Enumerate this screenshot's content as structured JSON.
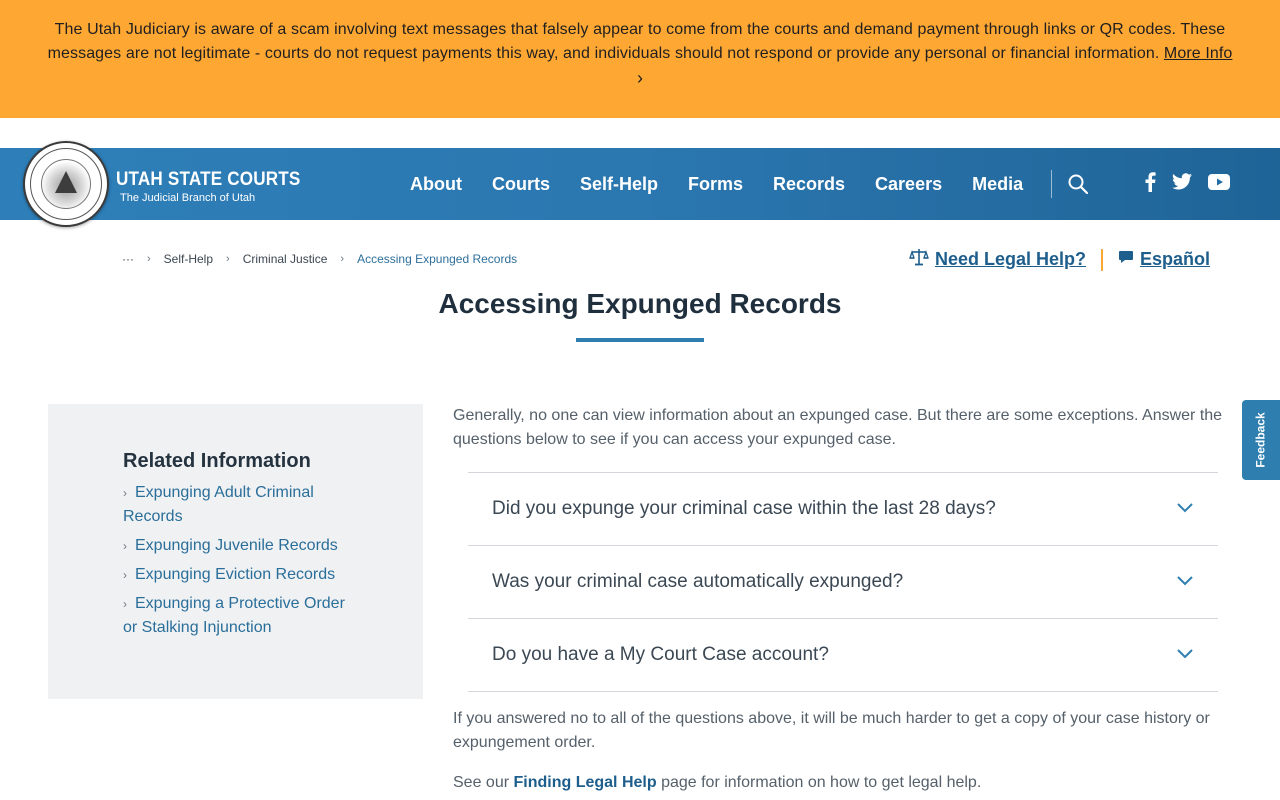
{
  "alert": {
    "text": "The Utah Judiciary is aware of a scam involving text messages that falsely appear to come from the courts and demand payment through links or QR codes. These messages are not legitimate - courts do not request payments this way, and individuals should not respond or provide any personal or financial information.",
    "link_label": "More Info",
    "chevron": "›"
  },
  "header": {
    "site_name": "UTAH STATE COURTS",
    "tagline": "The Judicial Branch of Utah",
    "nav": [
      "About",
      "Courts",
      "Self-Help",
      "Forms",
      "Records",
      "Careers",
      "Media"
    ],
    "icons": [
      "search-icon",
      "facebook-icon",
      "twitter-icon",
      "youtube-icon"
    ]
  },
  "breadcrumb": {
    "overflow": "···",
    "items": [
      "Self-Help",
      "Criminal Justice",
      "Accessing Expunged Records"
    ]
  },
  "utility": {
    "legal_help": "Need Legal Help?",
    "espanol": "Español"
  },
  "page": {
    "title": "Accessing Expunged Records"
  },
  "sidebar": {
    "heading": "Related Information",
    "links": [
      "Expunging Adult Criminal Records",
      "Expunging Juvenile Records",
      "Expunging Eviction Records",
      "Expunging a Protective Order or Stalking Injunction"
    ]
  },
  "content": {
    "intro": "Generally, no one can view information about an expunged case. But there are some exceptions. Answer the questions below to see if you can access your expunged case.",
    "questions": [
      "Did you expunge your criminal case within the last 28 days?",
      "Was your criminal case automatically expunged?",
      "Do you have a My Court Case account?"
    ],
    "after": "If you answered no to all of the questions above, it will be much harder to get a copy of your case history or expungement order.",
    "see_prefix": "See our",
    "see_link": "Finding Legal Help",
    "see_suffix": "page for information on how to get legal help."
  },
  "feedback": {
    "label": "Feedback"
  },
  "colors": {
    "alert_bg": "#ffa733",
    "header_blue": "#2b77b0",
    "link_blue": "#1e5e8c",
    "accent_bar": "#ffa733"
  }
}
